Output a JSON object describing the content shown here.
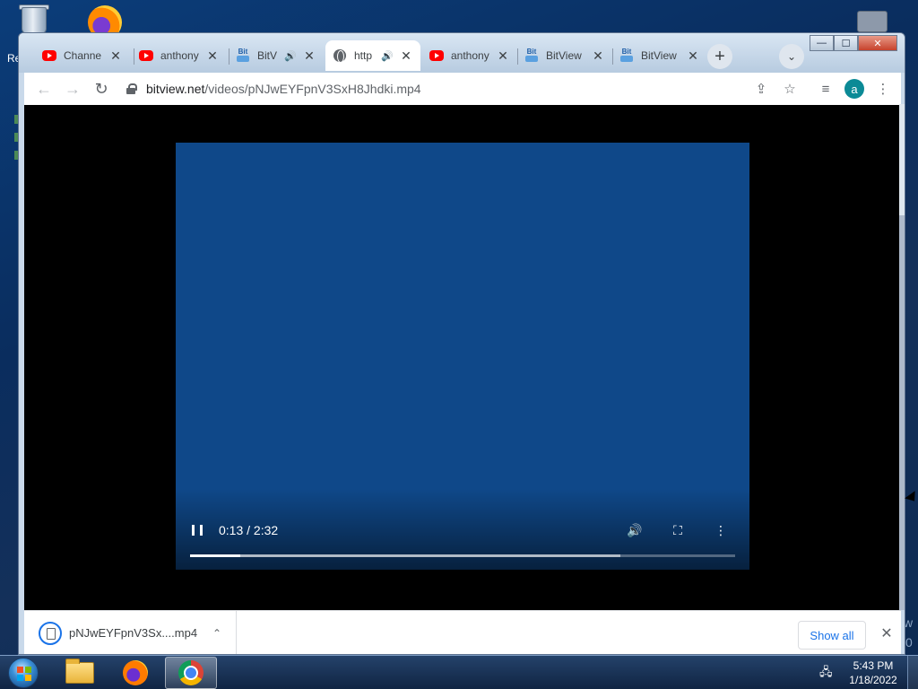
{
  "desktop": {
    "recycle_label": "Re",
    "right_hint_1": "w",
    "right_hint_2": "0"
  },
  "window": {
    "controls": {
      "minimize": "—",
      "maximize": "☐",
      "close": "✕"
    }
  },
  "tabs": [
    {
      "title": "Channe",
      "favicon": "youtube",
      "audio": false
    },
    {
      "title": "anthony",
      "favicon": "youtube",
      "audio": false
    },
    {
      "title": "BitV",
      "favicon": "bitview",
      "audio": true
    },
    {
      "title": "http",
      "favicon": "globe",
      "audio": true,
      "active": true
    },
    {
      "title": "anthony",
      "favicon": "youtube",
      "audio": false
    },
    {
      "title": "BitView",
      "favicon": "bitview",
      "audio": false
    },
    {
      "title": "BitView",
      "favicon": "bitview",
      "audio": false
    }
  ],
  "tab_icons": {
    "audio": "🔊",
    "close": "✕",
    "new_tab": "+",
    "tab_search": "⌄"
  },
  "toolbar": {
    "back": "←",
    "forward": "→",
    "reload": "↻",
    "url_domain": "bitview.net",
    "url_path": "/videos/pNJwEYFpnV3SxH8Jhdki.mp4",
    "share_icon": "⇪",
    "star_icon": "☆",
    "media_icon": "≡",
    "avatar_letter": "a",
    "menu_icon": "⋮"
  },
  "video": {
    "background": "#0f4889",
    "current_time": "0:13",
    "separator": " / ",
    "duration": "2:32",
    "played_fraction": 0.092,
    "buffered_fraction": 0.79,
    "icons": {
      "play_state": "pause-icon",
      "volume": "🔊",
      "fullscreen": "⛶",
      "more": "⋮"
    }
  },
  "download_shelf": {
    "file_name": "pNJwEYFpnV3Sx....mp4",
    "chevron": "⌃",
    "show_all": "Show all",
    "close": "✕"
  },
  "taskbar": {
    "apps": [
      "explorer",
      "firefox",
      "chrome"
    ],
    "active_app": "chrome",
    "tray_network_icon": "🖧",
    "time": "5:43 PM",
    "date": "1/18/2022"
  }
}
